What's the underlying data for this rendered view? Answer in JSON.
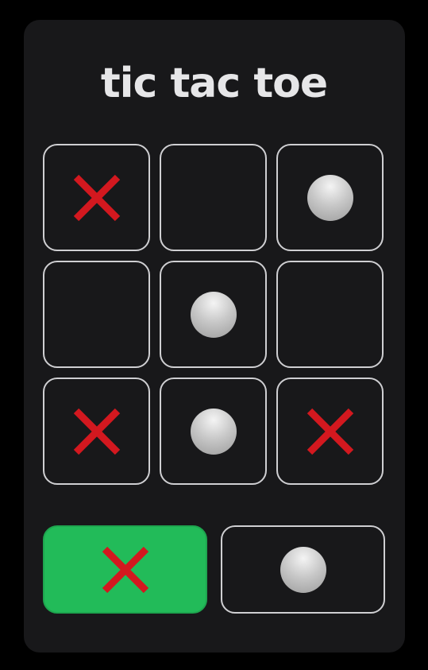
{
  "title": "tic tac toe",
  "colors": {
    "background": "#000000",
    "card": "#18181a",
    "cell_border": "#cfcfd2",
    "x_mark": "#d3181f",
    "o_mark": "#c8c8c8",
    "active_player": "#22bb59"
  },
  "board": [
    [
      "X",
      "",
      "O"
    ],
    [
      "",
      "O",
      ""
    ],
    [
      "X",
      "O",
      "X"
    ]
  ],
  "players": [
    {
      "symbol": "X",
      "icon": "x-icon",
      "active": true
    },
    {
      "symbol": "O",
      "icon": "o-icon",
      "active": false
    }
  ]
}
